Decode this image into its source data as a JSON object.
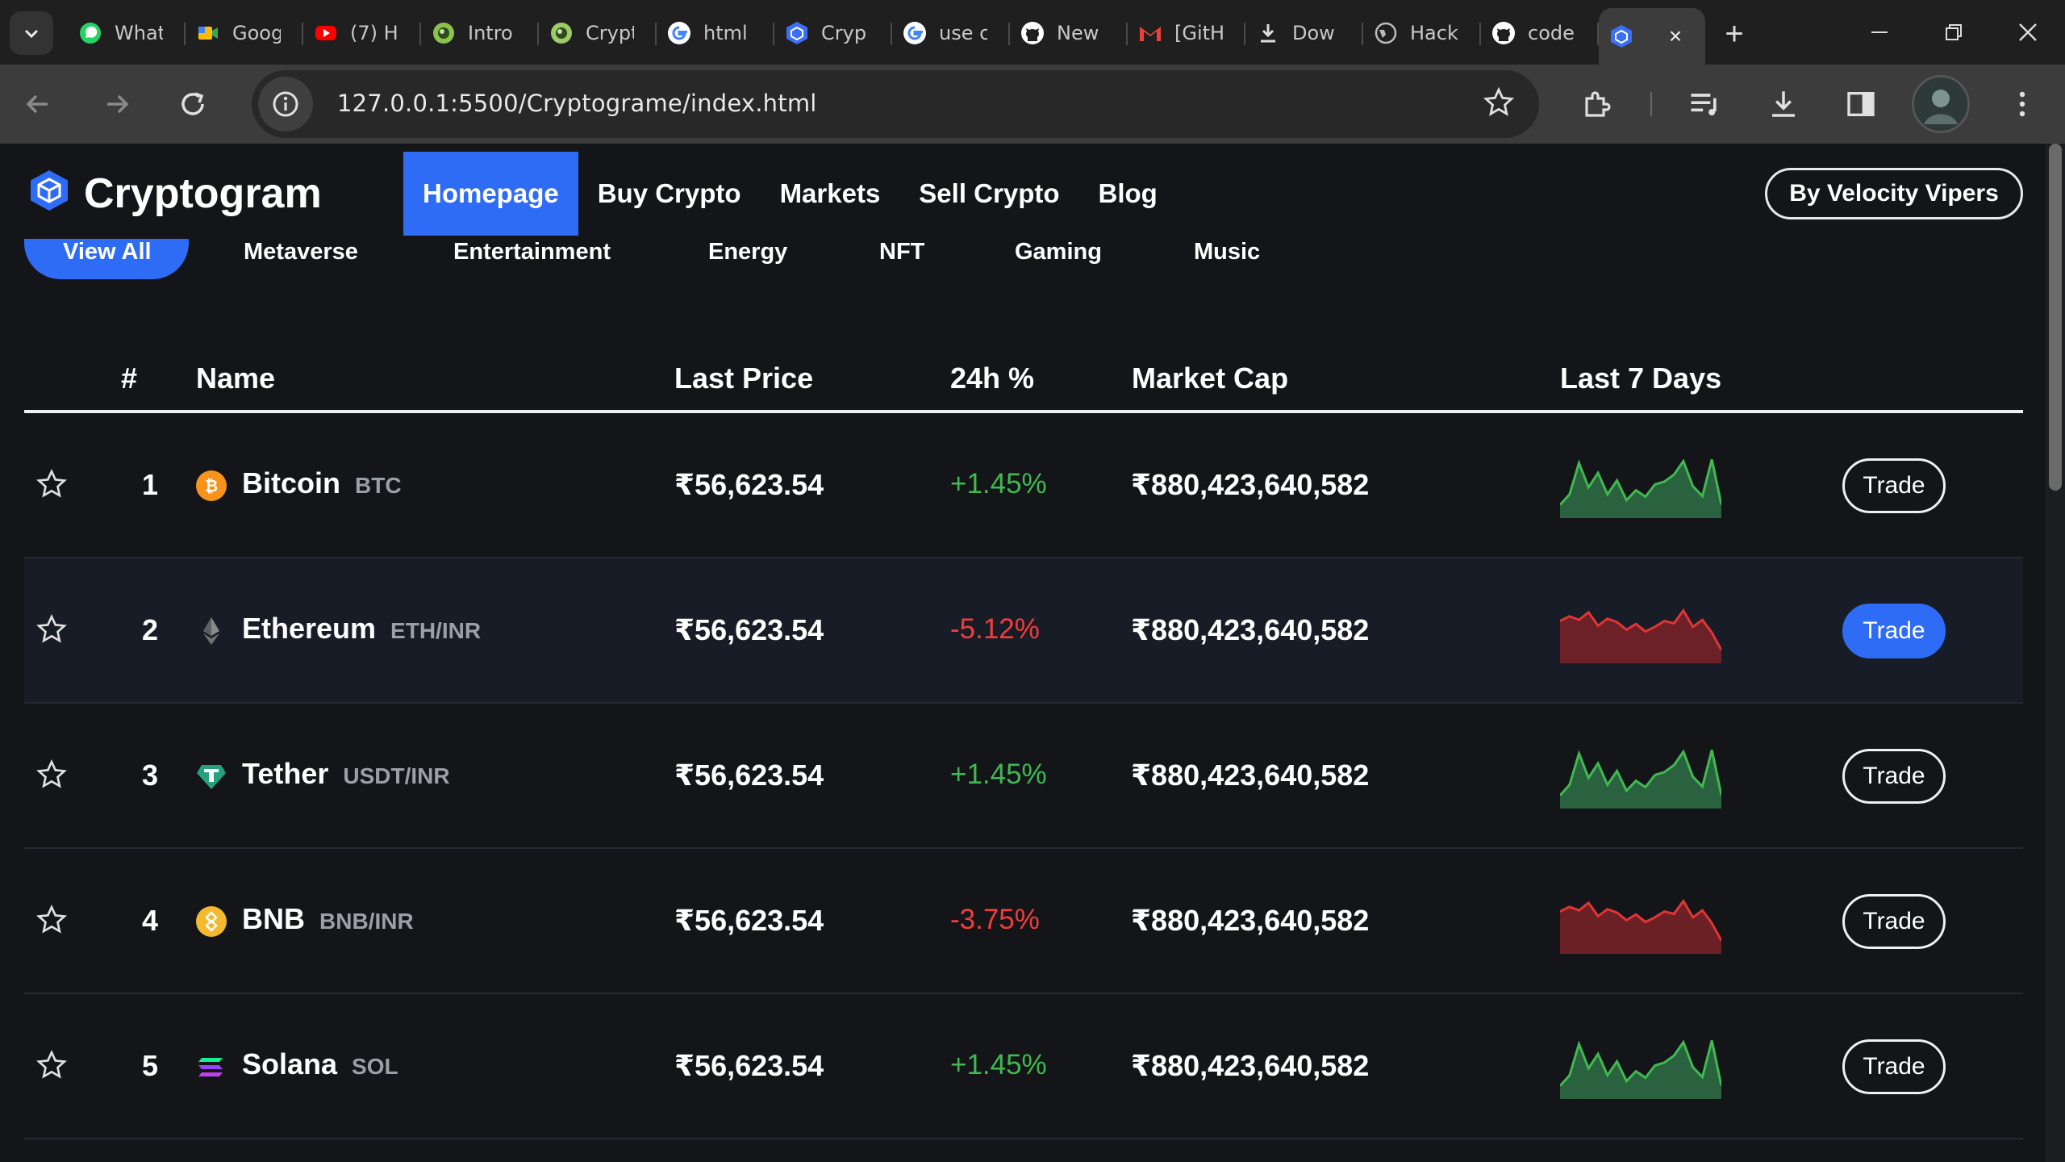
{
  "browser": {
    "tabs": [
      {
        "title": "What",
        "favicon": "whatsapp-icon",
        "color": "#25d366"
      },
      {
        "title": "Goog",
        "favicon": "google-meet-icon",
        "color": "#00897b"
      },
      {
        "title": "(7) H",
        "favicon": "youtube-icon",
        "color": "#ff0000"
      },
      {
        "title": "Intro",
        "favicon": "globe-lime-icon",
        "color": "#8bc34a"
      },
      {
        "title": "Crypt",
        "favicon": "globe-lime-icon",
        "color": "#9ccc65"
      },
      {
        "title": "html",
        "favicon": "google-icon",
        "color": "#ffffff"
      },
      {
        "title": "Cryp",
        "favicon": "cube-icon",
        "color": "#3b6ff5"
      },
      {
        "title": "use c",
        "favicon": "google-icon",
        "color": "#ffffff"
      },
      {
        "title": "New",
        "favicon": "github-icon",
        "color": "#ffffff"
      },
      {
        "title": "[GitH",
        "favicon": "gmail-icon",
        "color": "#ea4335"
      },
      {
        "title": "Dow",
        "favicon": "download-icon",
        "color": "#dddddd"
      },
      {
        "title": "Hack",
        "favicon": "globe-icon",
        "color": "#bbbbbb"
      },
      {
        "title": "code",
        "favicon": "github-icon",
        "color": "#ffffff"
      }
    ],
    "active_tab": {
      "favicon": "cube-icon",
      "close": "×"
    },
    "new_tab": "+",
    "url": "127.0.0.1:5500/Cryptograme/index.html"
  },
  "site": {
    "brand": "Cryptogram",
    "accent": "#2f6cf6",
    "nav": [
      "Homepage",
      "Buy Crypto",
      "Markets",
      "Sell Crypto",
      "Blog"
    ],
    "active_nav": "Homepage",
    "credit_button": "By Velocity Vipers"
  },
  "filters": [
    "View All",
    "Metaverse",
    "Entertainment",
    "Energy",
    "NFT",
    "Gaming",
    "Music"
  ],
  "table": {
    "headers": {
      "rank": "#",
      "name": "Name",
      "price": "Last Price",
      "change": "24h %",
      "mcap": "Market Cap",
      "chart": "Last 7 Days"
    },
    "rows": [
      {
        "rank": "1",
        "name": "Bitcoin",
        "symbol": "BTC",
        "icon": "bitcoin-icon",
        "price": "₹56,623.54",
        "change": "+1.45%",
        "trend": "up",
        "mcap": "₹880,423,640,582",
        "trade": "Trade",
        "highlight": false
      },
      {
        "rank": "2",
        "name": "Ethereum",
        "symbol": "ETH/INR",
        "icon": "ethereum-icon",
        "price": "₹56,623.54",
        "change": "-5.12%",
        "trend": "down",
        "mcap": "₹880,423,640,582",
        "trade": "Trade",
        "highlight": true
      },
      {
        "rank": "3",
        "name": "Tether",
        "symbol": "USDT/INR",
        "icon": "tether-icon",
        "price": "₹56,623.54",
        "change": "+1.45%",
        "trend": "up",
        "mcap": "₹880,423,640,582",
        "trade": "Trade",
        "highlight": false
      },
      {
        "rank": "4",
        "name": "BNB",
        "symbol": "BNB/INR",
        "icon": "bnb-icon",
        "price": "₹56,623.54",
        "change": "-3.75%",
        "trend": "down",
        "mcap": "₹880,423,640,582",
        "trade": "Trade",
        "highlight": false
      },
      {
        "rank": "5",
        "name": "Solana",
        "symbol": "SOL",
        "icon": "solana-icon",
        "price": "₹56,623.54",
        "change": "+1.45%",
        "trend": "up",
        "mcap": "₹880,423,640,582",
        "trade": "Trade",
        "highlight": false
      }
    ]
  }
}
